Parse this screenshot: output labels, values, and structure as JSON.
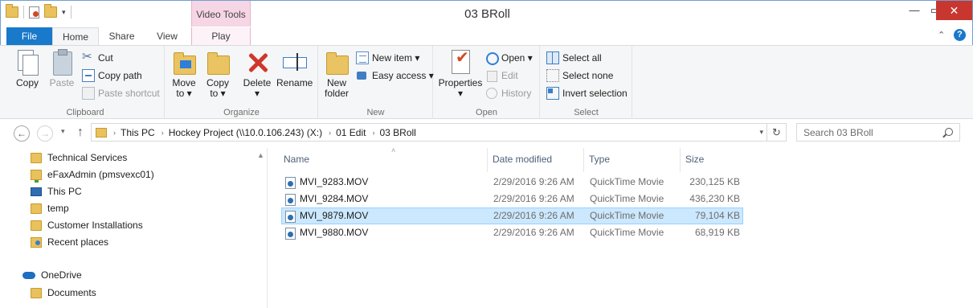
{
  "window": {
    "title": "03 BRoll",
    "context_tab_group": "Video Tools",
    "controls": {
      "minimize": "—",
      "maximize": "▭",
      "close": "✕"
    }
  },
  "quick_access": {
    "dropdown": "▾"
  },
  "tabs": [
    {
      "label": "File"
    },
    {
      "label": "Home"
    },
    {
      "label": "Share"
    },
    {
      "label": "View"
    },
    {
      "label": "Play"
    }
  ],
  "ribbon": {
    "collapse": "⌃",
    "help": "?",
    "clipboard": {
      "label": "Clipboard",
      "copy": "Copy",
      "paste": "Paste",
      "cut": "Cut",
      "copy_path": "Copy path",
      "paste_shortcut": "Paste shortcut"
    },
    "organize": {
      "label": "Organize",
      "move_to": [
        "Move",
        "to ▾"
      ],
      "copy_to": [
        "Copy",
        "to ▾"
      ],
      "delete": [
        "Delete",
        "▾"
      ],
      "rename": "Rename"
    },
    "new": {
      "label": "New",
      "new_folder": [
        "New",
        "folder"
      ],
      "new_item": "New item ▾",
      "easy_access": "Easy access ▾"
    },
    "open": {
      "label": "Open",
      "properties": [
        "Properties",
        "▾"
      ],
      "open": "Open ▾",
      "edit": "Edit",
      "history": "History"
    },
    "select": {
      "label": "Select",
      "select_all": "Select all",
      "select_none": "Select none",
      "invert_selection": "Invert selection"
    }
  },
  "address": {
    "back": "←",
    "forward": "→",
    "recent": "▾",
    "up": "↑",
    "breadcrumbs": [
      "This PC",
      "Hockey Project (\\\\10.0.106.243) (X:)",
      "01 Edit",
      "03 BRoll"
    ],
    "crumb_separator": "›",
    "dropdown": "▾",
    "refresh": "↻"
  },
  "search": {
    "placeholder": "Search 03 BRoll"
  },
  "nav_pane": {
    "scroll_up": "▲",
    "items": [
      {
        "label": "Technical Services",
        "icon": "folder-icon"
      },
      {
        "label": "eFaxAdmin (pmsvexc01)",
        "icon": "network-folder-icon"
      },
      {
        "label": "This PC",
        "icon": "computer-icon"
      },
      {
        "label": "temp",
        "icon": "folder-icon"
      },
      {
        "label": "Customer Installations",
        "icon": "folder-icon"
      },
      {
        "label": "Recent places",
        "icon": "recent-places-icon"
      },
      {
        "label": "OneDrive",
        "icon": "onedrive-cloud-icon"
      },
      {
        "label": "Documents",
        "icon": "folder-icon"
      }
    ]
  },
  "file_list": {
    "sort_indicator": "˄",
    "columns": [
      "Name",
      "Date modified",
      "Type",
      "Size"
    ],
    "rows": [
      {
        "name": "MVI_9283.MOV",
        "date": "2/29/2016 9:26 AM",
        "type": "QuickTime Movie",
        "size": "230,125 KB",
        "selected": false
      },
      {
        "name": "MVI_9284.MOV",
        "date": "2/29/2016 9:26 AM",
        "type": "QuickTime Movie",
        "size": "436,230 KB",
        "selected": false
      },
      {
        "name": "MVI_9879.MOV",
        "date": "2/29/2016 9:26 AM",
        "type": "QuickTime Movie",
        "size": "79,104 KB",
        "selected": true
      },
      {
        "name": "MVI_9880.MOV",
        "date": "2/29/2016 9:26 AM",
        "type": "QuickTime Movie",
        "size": "68,919 KB",
        "selected": false
      }
    ]
  },
  "colors": {
    "file_tab": "#1979ca",
    "video_tools": "#f6d6e4",
    "selection": "#cce8ff",
    "close_button": "#c7372f"
  }
}
